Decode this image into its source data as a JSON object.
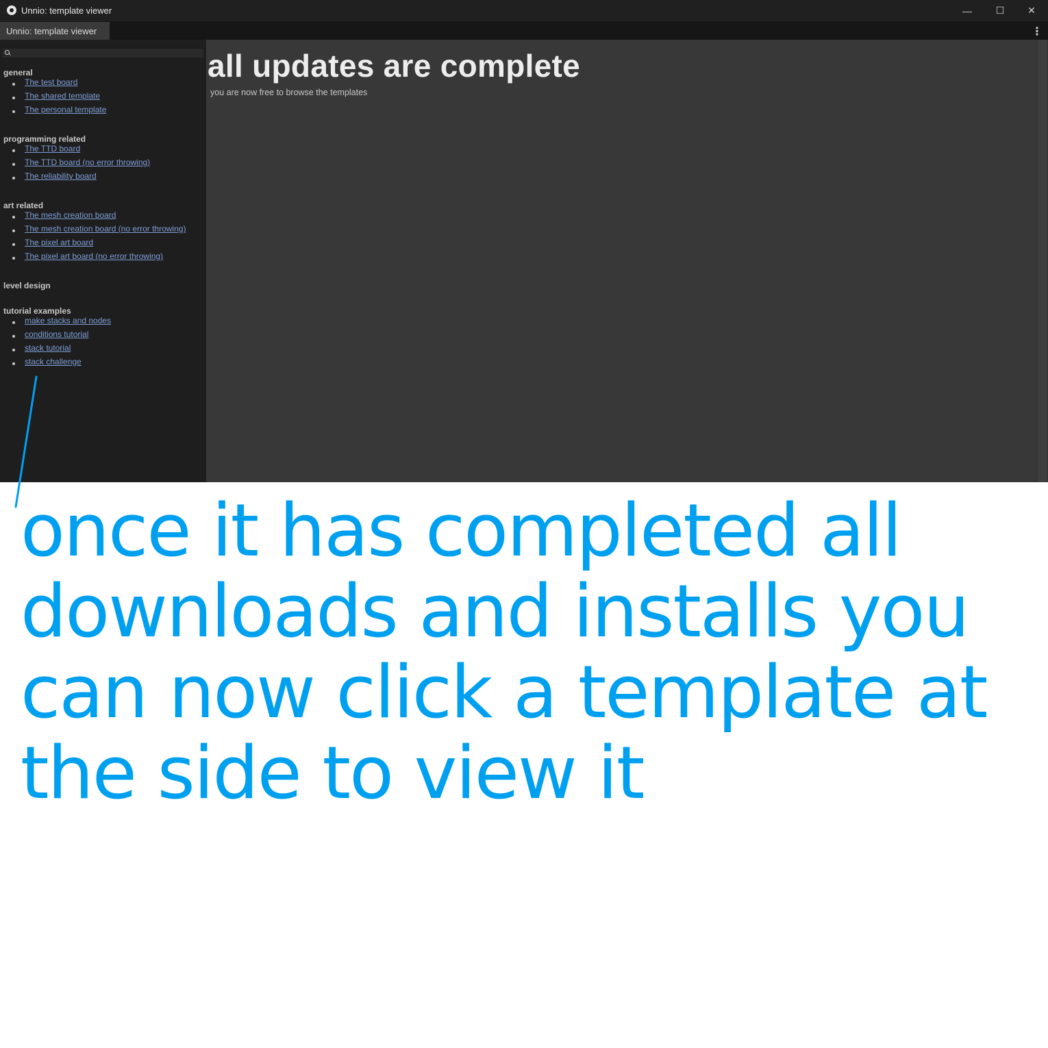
{
  "window": {
    "title": "Unnio: template viewer",
    "controls": {
      "minimize": "—",
      "maximize": "☐",
      "close": "✕"
    }
  },
  "tab": {
    "label": "Unnio: template viewer",
    "menu": "⋮"
  },
  "sidebar": {
    "groups": [
      {
        "title": "general",
        "items": [
          "The test board",
          "The shared template",
          "The personal template"
        ]
      },
      {
        "title": "programming related",
        "items": [
          "The TTD board",
          "The TTD board (no error throwing)",
          "The reliability board"
        ]
      },
      {
        "title": "art related",
        "items": [
          "The mesh creation board",
          "The mesh creation board (no error throwing)",
          "The pixel art board",
          "The pixel art board (no error throwing)"
        ]
      },
      {
        "title": "level design",
        "items": []
      },
      {
        "title": "tutorial examples",
        "items": [
          "make stacks and nodes",
          "conditions tutorial",
          "stack tutorial",
          "stack challenge"
        ]
      }
    ]
  },
  "main": {
    "heading": "all updates are complete",
    "subtext": "you are now free to browse the templates"
  },
  "annotation": {
    "text": "once it has completed all downloads and installs you can now click a template at the side to view it",
    "color": "#00a0f0"
  }
}
